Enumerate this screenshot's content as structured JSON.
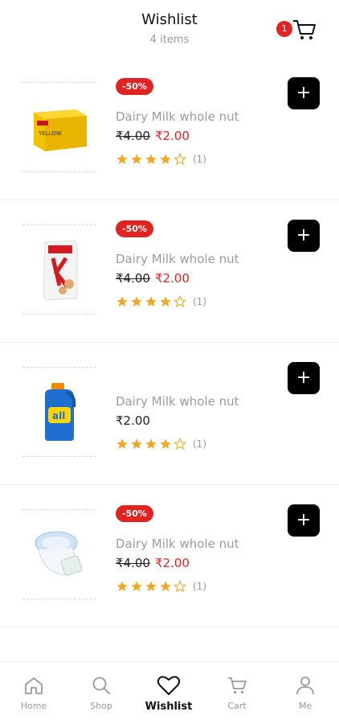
{
  "header": {
    "title": "Wishlist",
    "subtitle": "4 items",
    "cart_count": "1"
  },
  "items": [
    {
      "discount": "-50%",
      "name": "Dairy Milk whole nut",
      "old_price": "₹4.00",
      "price": "₹2.00",
      "rating_count": "(1)",
      "rating": 4,
      "image": "tea-box-icon"
    },
    {
      "discount": "-50%",
      "name": "Dairy Milk whole nut",
      "old_price": "₹4.00",
      "price": "₹2.00",
      "rating_count": "(1)",
      "rating": 4,
      "image": "cereal-box-icon"
    },
    {
      "discount": "",
      "name": "Dairy Milk whole nut",
      "old_price": "",
      "price": "₹2.00",
      "rating_count": "(1)",
      "rating": 4,
      "image": "detergent-bottle-icon"
    },
    {
      "discount": "-50%",
      "name": "Dairy Milk whole nut",
      "old_price": "₹4.00",
      "price": "₹2.00",
      "rating_count": "(1)",
      "rating": 4,
      "image": "diapers-pack-icon"
    }
  ],
  "add_label": "+",
  "tabs": [
    {
      "label": "Home",
      "icon": "home-icon"
    },
    {
      "label": "Shop",
      "icon": "search-icon"
    },
    {
      "label": "Wishlist",
      "icon": "heart-icon",
      "active": true
    },
    {
      "label": "Cart",
      "icon": "cart-icon"
    },
    {
      "label": "Me",
      "icon": "user-icon"
    }
  ],
  "colors": {
    "accent": "#e02424",
    "star": "#f5a623",
    "button": "#000000"
  }
}
